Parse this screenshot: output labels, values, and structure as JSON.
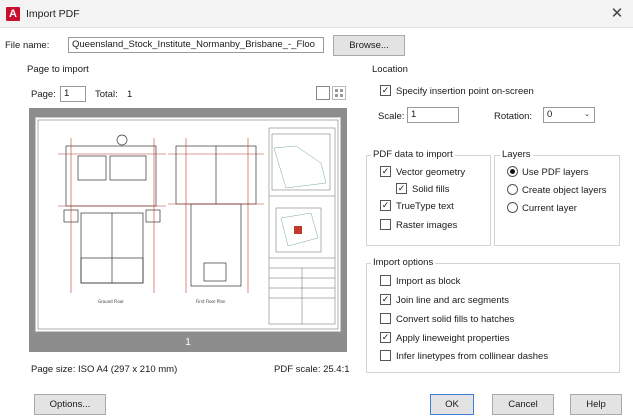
{
  "window": {
    "title": "Import PDF",
    "app_logo": "A"
  },
  "file": {
    "label": "File name:",
    "value": "Queensland_Stock_Institute_Normanby_Brisbane_-_Floo",
    "browse_label": "Browse..."
  },
  "page_to_import": {
    "title": "Page to import",
    "page_label": "Page:",
    "page_value": "1",
    "total_label": "Total:",
    "total_value": "1",
    "preview_page_number": "1",
    "page_size_text": "Page size: ISO A4 (297 x 210 mm)",
    "pdf_scale_text": "PDF scale: 25.4:1",
    "drawing_labels": {
      "ground": "Ground Floor",
      "first": "First Floor Plan"
    }
  },
  "location": {
    "title": "Location",
    "specify_label": "Specify insertion point on-screen",
    "specify_checked": true,
    "scale_label": "Scale:",
    "scale_value": "1",
    "rotation_label": "Rotation:",
    "rotation_value": "0"
  },
  "pdf_data": {
    "title": "PDF data to import",
    "vector_label": "Vector geometry",
    "vector_checked": true,
    "solid_fills_label": "Solid fills",
    "solid_fills_checked": true,
    "truetype_label": "TrueType text",
    "truetype_checked": true,
    "raster_label": "Raster images",
    "raster_checked": false
  },
  "layers": {
    "title": "Layers",
    "options": [
      {
        "label": "Use PDF layers",
        "selected": true
      },
      {
        "label": "Create object layers",
        "selected": false
      },
      {
        "label": "Current layer",
        "selected": false
      }
    ]
  },
  "import_options": {
    "title": "Import options",
    "items": [
      {
        "label": "Import as block",
        "checked": false
      },
      {
        "label": "Join line and arc segments",
        "checked": true
      },
      {
        "label": "Convert solid fills to hatches",
        "checked": false
      },
      {
        "label": "Apply lineweight properties",
        "checked": true
      },
      {
        "label": "Infer linetypes from collinear dashes",
        "checked": false
      }
    ]
  },
  "buttons": {
    "options": "Options...",
    "ok": "OK",
    "cancel": "Cancel",
    "help": "Help"
  },
  "colors": {
    "accent": "#c8102e",
    "preview_bg": "#8d8d8d",
    "dialog_bg": "#ffffff"
  }
}
